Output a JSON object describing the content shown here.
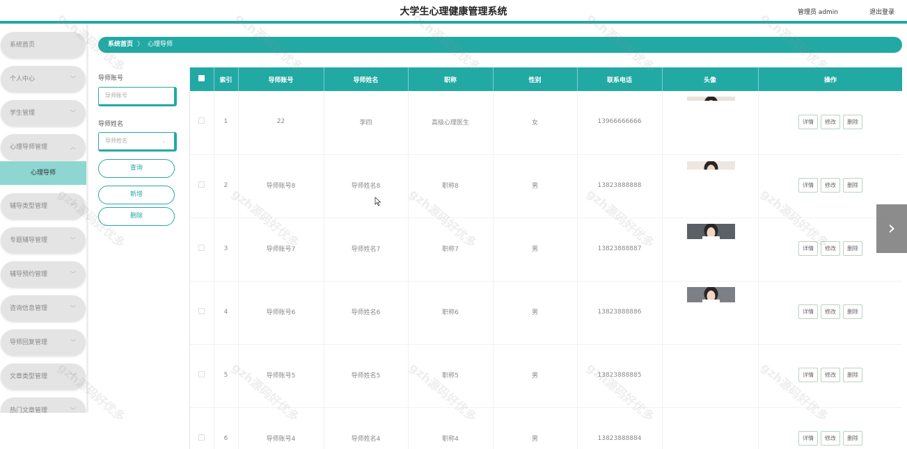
{
  "header": {
    "title": "大学生心理健康管理系统",
    "user": "管理员 admin",
    "logout": "退出登录"
  },
  "sidebar": {
    "items": [
      {
        "label": "系统首页",
        "chevron": false
      },
      {
        "label": "个人中心",
        "chevron": true
      },
      {
        "label": "学生管理",
        "chevron": true
      },
      {
        "label": "心理导师管理",
        "chevron": true,
        "expanded": true
      },
      {
        "label": "辅导类型管理",
        "chevron": true
      },
      {
        "label": "专题辅导管理",
        "chevron": true
      },
      {
        "label": "辅导预约管理",
        "chevron": true
      },
      {
        "label": "咨询信息管理",
        "chevron": true
      },
      {
        "label": "导师回复管理",
        "chevron": true
      },
      {
        "label": "文章类型管理",
        "chevron": true
      },
      {
        "label": "热门文章管理",
        "chevron": true
      }
    ],
    "sub_item": "心理导师"
  },
  "breadcrumb": {
    "home": "系统首页",
    "separator": "〉",
    "current": "心理导师"
  },
  "filters": {
    "account_label": "导师账号",
    "account_placeholder": "导师账号",
    "name_label": "导师姓名",
    "name_placeholder": "导师姓名",
    "query_btn": "查询",
    "add_btn": "新增",
    "delete_btn": "删除"
  },
  "table": {
    "columns": [
      "索引",
      "导师账号",
      "导师姓名",
      "职称",
      "性别",
      "联系电话",
      "头像",
      "操作"
    ],
    "rows": [
      {
        "index": "1",
        "account": "22",
        "name": "李四",
        "title": "高级心理医生",
        "gender": "女",
        "phone": "13966666666"
      },
      {
        "index": "2",
        "account": "导师账号8",
        "name": "导师姓名8",
        "title": "职称8",
        "gender": "男",
        "phone": "13823888888"
      },
      {
        "index": "3",
        "account": "导师账号7",
        "name": "导师姓名7",
        "title": "职称7",
        "gender": "男",
        "phone": "13823888887"
      },
      {
        "index": "4",
        "account": "导师账号6",
        "name": "导师姓名6",
        "title": "职称6",
        "gender": "男",
        "phone": "13823888886"
      },
      {
        "index": "5",
        "account": "导师账号5",
        "name": "导师姓名5",
        "title": "职称5",
        "gender": "男",
        "phone": "13823888885"
      },
      {
        "index": "6",
        "account": "导师账号4",
        "name": "导师姓名4",
        "title": "职称4",
        "gender": "男",
        "phone": "13823888884"
      }
    ],
    "actions": {
      "detail": "详情",
      "edit": "修改",
      "delete": "删除"
    }
  },
  "watermark": "gzh源码好优多",
  "colors": {
    "accent": "#22a9a4",
    "submenu_active": "#8ed6d1",
    "sidebar_item": "#e4e4e4"
  }
}
